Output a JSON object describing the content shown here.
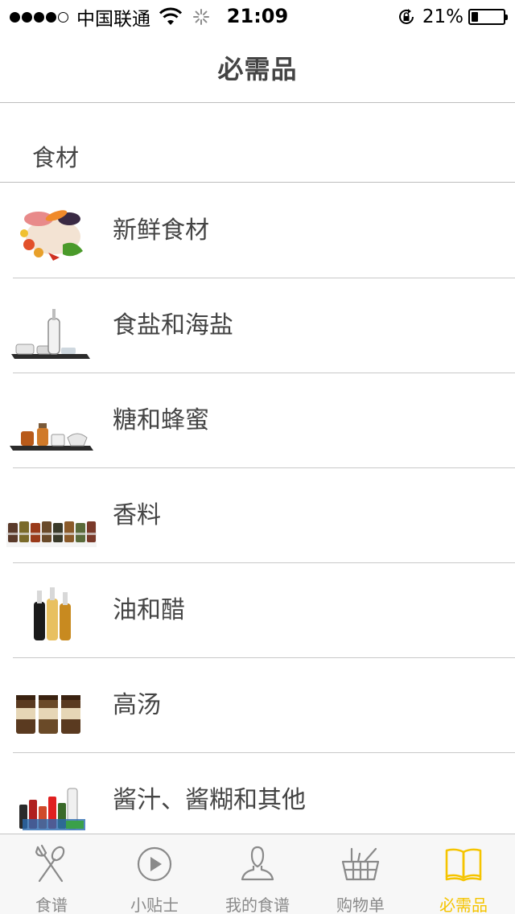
{
  "status_bar": {
    "carrier": "中国联通",
    "time": "21:09",
    "battery_percent": "21%",
    "battery_level": 0.21,
    "signal_bars_filled": 4,
    "signal_bars_total": 5
  },
  "nav": {
    "title": "必需品"
  },
  "section": {
    "title": "食材"
  },
  "items": [
    {
      "label": "新鲜食材",
      "icon": "fresh-food-thumbnail"
    },
    {
      "label": "食盐和海盐",
      "icon": "salt-thumbnail"
    },
    {
      "label": "糖和蜂蜜",
      "icon": "sugar-honey-thumbnail"
    },
    {
      "label": "香料",
      "icon": "spices-thumbnail"
    },
    {
      "label": "油和醋",
      "icon": "oil-vinegar-thumbnail"
    },
    {
      "label": "高汤",
      "icon": "stock-thumbnail"
    },
    {
      "label": "酱汁、酱糊和其他",
      "icon": "sauces-thumbnail"
    }
  ],
  "tabs": [
    {
      "label": "食谱",
      "icon": "spoon-fork-icon",
      "active": false
    },
    {
      "label": "小贴士",
      "icon": "play-icon",
      "active": false
    },
    {
      "label": "我的食谱",
      "icon": "user-icon",
      "active": false
    },
    {
      "label": "购物单",
      "icon": "basket-icon",
      "active": false
    },
    {
      "label": "必需品",
      "icon": "book-icon",
      "active": true
    }
  ],
  "colors": {
    "accent": "#f5c400",
    "tab_inactive": "#8a8a8a",
    "divider": "#c8c8c8"
  }
}
